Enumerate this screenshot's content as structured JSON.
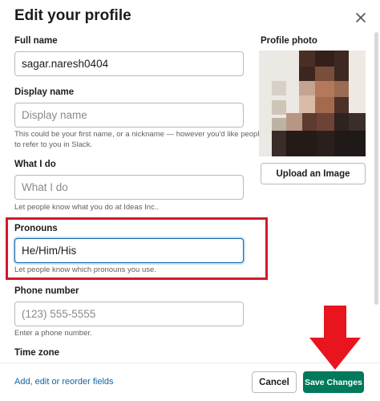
{
  "modal": {
    "title": "Edit your profile",
    "close_icon": "close-icon"
  },
  "fields": {
    "full_name": {
      "label": "Full name",
      "value": "sagar.naresh0404"
    },
    "display_name": {
      "label": "Display name",
      "placeholder": "Display name",
      "hint_line1": "This could be your first name, or a nickname — however you'd like people",
      "hint_line2": "to refer to you in Slack."
    },
    "what_i_do": {
      "label": "What I do",
      "placeholder": "What I do",
      "hint": "Let people know what you do at Ideas Inc.."
    },
    "pronouns": {
      "label": "Pronouns",
      "value": "He/Him/His",
      "hint": "Let people know which pronouns you use."
    },
    "phone": {
      "label": "Phone number",
      "placeholder": "(123) 555-5555",
      "hint": "Enter a phone number."
    },
    "time_zone": {
      "label": "Time zone"
    }
  },
  "photo": {
    "label": "Profile photo",
    "upload_label": "Upload an Image"
  },
  "footer": {
    "link": "Add, edit or reorder fields",
    "cancel_label": "Cancel",
    "save_label": "Save Changes"
  },
  "colors": {
    "highlight": "#d11a2a",
    "save_button": "#007a5a",
    "link": "#1264a3",
    "arrow": "#e8141e"
  }
}
